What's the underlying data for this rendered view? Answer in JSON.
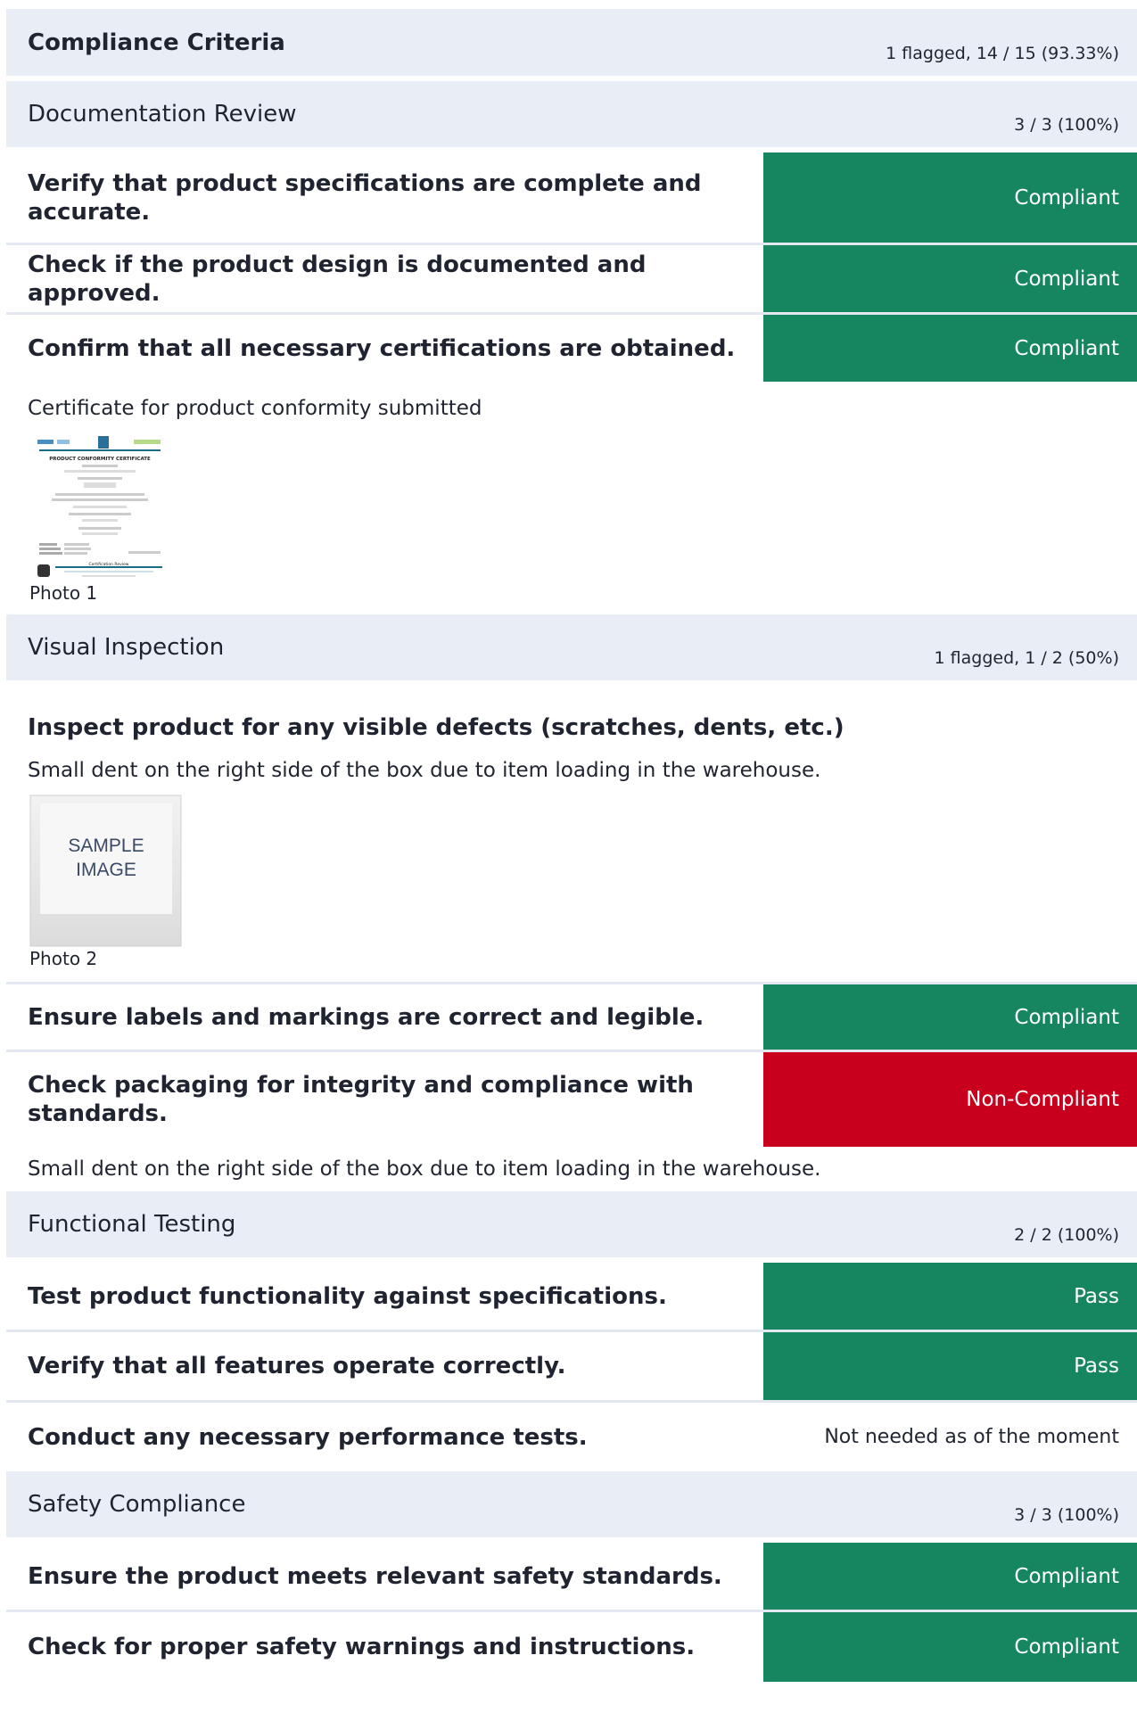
{
  "report": {
    "title": "Compliance Criteria",
    "summary": "1 flagged, 14 / 15 (93.33%)"
  },
  "sections": [
    {
      "name": "Documentation Review",
      "summary": "3 / 3 (100%)",
      "items": [
        {
          "question": "Verify that product specifications are complete and accurate.",
          "answer": "Compliant"
        },
        {
          "question": "Check if the product design is documented and approved.",
          "answer": "Compliant"
        },
        {
          "question": "Confirm that all necessary certifications are obtained.",
          "answer": "Compliant",
          "note": "Certificate for product conformity submitted",
          "photo_caption": "Photo 1"
        }
      ]
    },
    {
      "name": "Visual Inspection",
      "summary": "1 flagged, 1 / 2 (50%)",
      "items": [
        {
          "question": "Inspect product for any visible defects (scratches, dents, etc.)",
          "answer": "",
          "note": "Small dent on the right side of the box due to item loading in the warehouse.",
          "photo_caption": "Photo 2",
          "photo_text": "SAMPLE\nIMAGE"
        },
        {
          "question": "Ensure labels and markings are correct and legible.",
          "answer": "Compliant"
        },
        {
          "question": "Check packaging for integrity and compliance with standards.",
          "answer": "Non-Compliant",
          "note": "Small dent on the right side of the box due to item loading in the warehouse."
        }
      ]
    },
    {
      "name": "Functional Testing",
      "summary": "2 / 2 (100%)",
      "items": [
        {
          "question": "Test product functionality against specifications.",
          "answer": "Pass"
        },
        {
          "question": "Verify that all features operate correctly.",
          "answer": "Pass"
        },
        {
          "question": "Conduct any necessary performance tests.",
          "answer": "Not needed as of the moment"
        }
      ]
    },
    {
      "name": "Safety Compliance",
      "summary": "3 / 3 (100%)",
      "items": [
        {
          "question": "Ensure the product meets relevant safety standards.",
          "answer": "Compliant"
        },
        {
          "question": "Check for proper safety warnings and instructions.",
          "answer": "Compliant"
        }
      ]
    }
  ],
  "certificate_thumb": {
    "heading": "PRODUCT CONFORMITY CERTIFICATE",
    "footer": "Certification Review"
  },
  "colors": {
    "compliant": "#158660",
    "non_compliant": "#c8001e",
    "section_bg": "#e9edf6"
  }
}
